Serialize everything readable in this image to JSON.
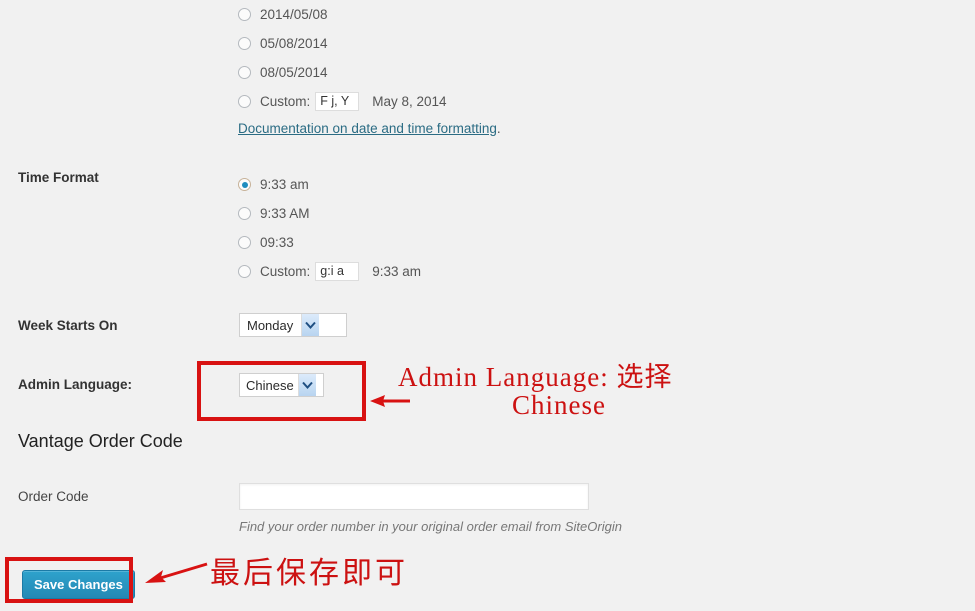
{
  "date_format": {
    "options": [
      {
        "label": "2014/05/08",
        "checked": false
      },
      {
        "label": "05/08/2014",
        "checked": false
      },
      {
        "label": "08/05/2014",
        "checked": false
      }
    ],
    "custom": {
      "prefix": "Custom:",
      "value": "F j, Y",
      "preview": "May 8, 2014",
      "checked": false
    },
    "doc_link": "Documentation on date and time formatting",
    "doc_link_suffix": "."
  },
  "time_format": {
    "label": "Time Format",
    "options": [
      {
        "label": "9:33 am",
        "checked": true
      },
      {
        "label": "9:33 AM",
        "checked": false
      },
      {
        "label": "09:33",
        "checked": false
      }
    ],
    "custom": {
      "prefix": "Custom:",
      "value": "g:i a",
      "preview": "9:33 am",
      "checked": false
    }
  },
  "week_starts_on": {
    "label": "Week Starts On",
    "selected": "Monday"
  },
  "admin_language": {
    "label": "Admin Language:",
    "selected": "Chinese"
  },
  "vantage_order_code": {
    "heading": "Vantage Order Code",
    "order_code_label": "Order Code",
    "order_code_value": "",
    "order_code_placeholder": "",
    "hint": "Find your order number in your original order email from SiteOrigin"
  },
  "actions": {
    "save_label": "Save Changes"
  },
  "annotations": {
    "language_note_line1": "Admin Language:  选择",
    "language_note_line2": "Chinese",
    "save_note": "最后保存即可"
  },
  "colors": {
    "annotation_red": "#cc1111",
    "annotation_box_red": "#d81212",
    "primary_button": "#2ea2cc",
    "link": "#2b6c84",
    "radio_dot": "#1e8cbe"
  }
}
